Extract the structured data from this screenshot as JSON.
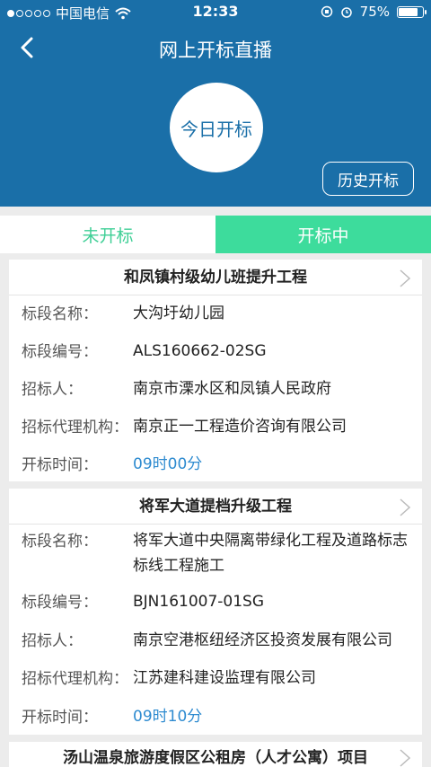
{
  "status_bar": {
    "carrier": "中国电信",
    "time": "12:33",
    "battery": "75%"
  },
  "header": {
    "title": "网上开标直播",
    "today_button": "今日开标",
    "history_button": "历史开标"
  },
  "tabs": [
    {
      "label": "未开标"
    },
    {
      "label": "开标中"
    }
  ],
  "cards": [
    {
      "title": "和凤镇村级幼儿班提升工程",
      "fields": [
        {
          "label": "标段名称：",
          "value": "大沟圩幼儿园"
        },
        {
          "label": "标段编号：",
          "value": "ALS160662-02SG"
        },
        {
          "label": "招标人：",
          "value": "南京市溧水区和凤镇人民政府"
        },
        {
          "label": "招标代理机构：",
          "value": "南京正一工程造价咨询有限公司"
        },
        {
          "label": "开标时间：",
          "value": "09时00分"
        }
      ]
    },
    {
      "title": "将军大道提档升级工程",
      "fields": [
        {
          "label": "标段名称：",
          "value": "将军大道中央隔离带绿化工程及道路标志标线工程施工"
        },
        {
          "label": "标段编号：",
          "value": "BJN161007-01SG"
        },
        {
          "label": "招标人：",
          "value": "南京空港枢纽经济区投资发展有限公司"
        },
        {
          "label": "招标代理机构：",
          "value": "江苏建科建设监理有限公司"
        },
        {
          "label": "开标时间：",
          "value": "09时10分"
        }
      ]
    },
    {
      "title": "汤山温泉旅游度假区公租房（人才公寓）项目"
    }
  ],
  "colors": {
    "header": "#1a6fa8",
    "tab_active": "#3ddc9c",
    "time_value": "#2e8bd0"
  }
}
